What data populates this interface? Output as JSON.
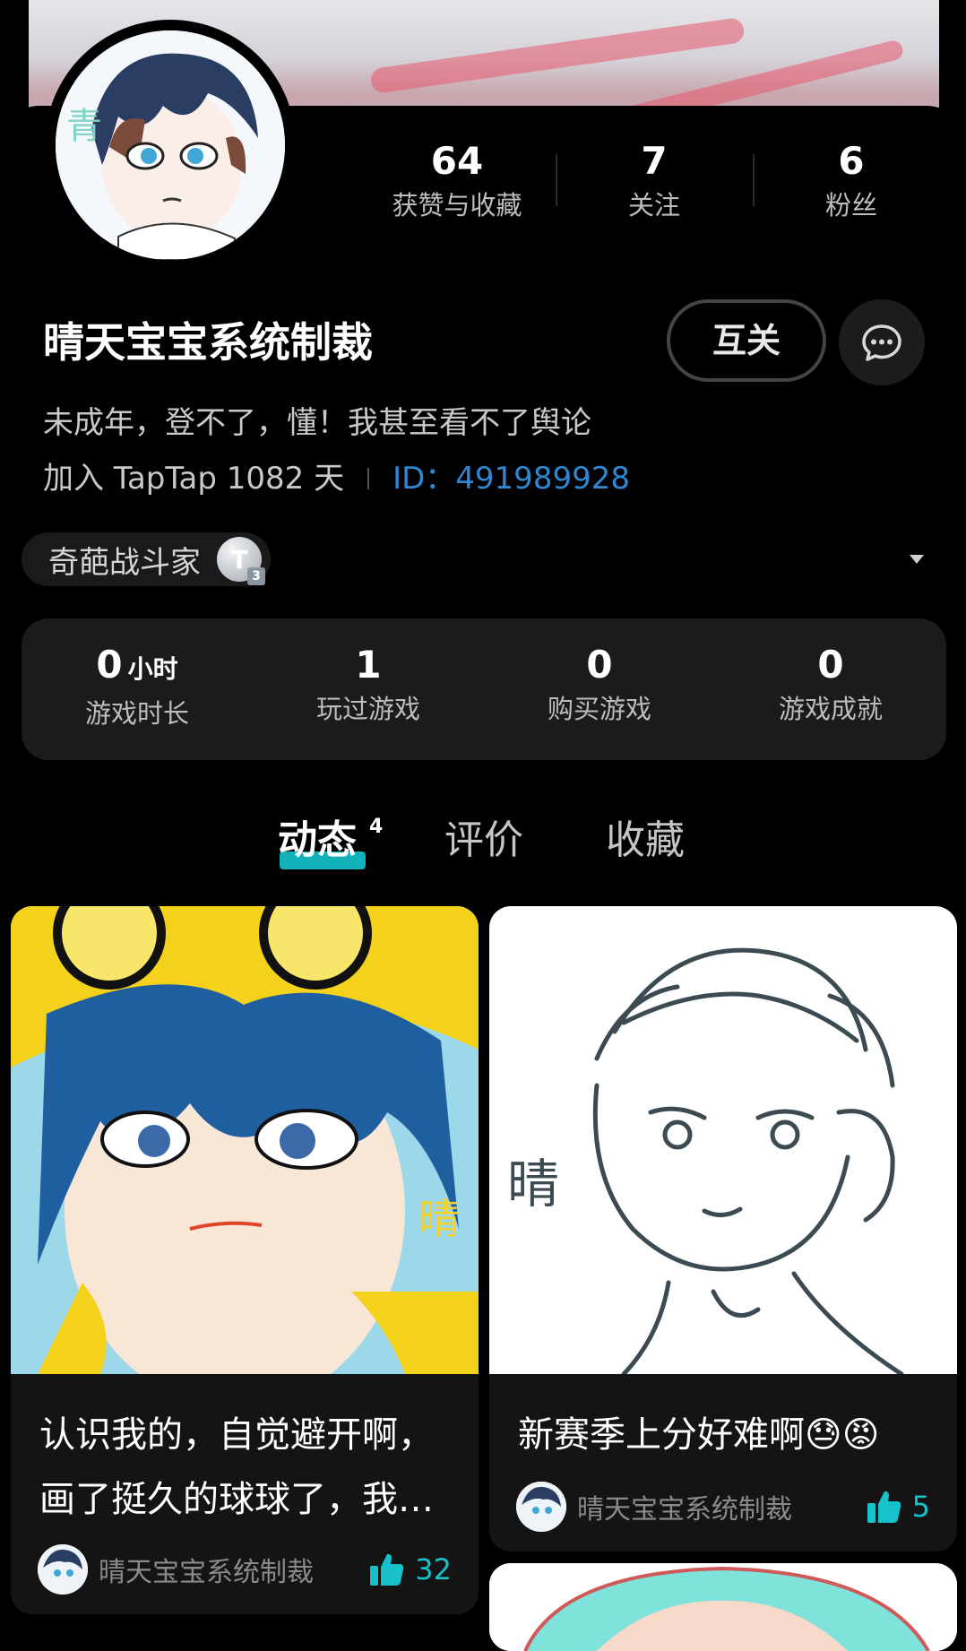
{
  "profile": {
    "name": "晴天宝宝系统制裁",
    "bio": "未成年，登不了，懂！我甚至看不了舆论",
    "join_text": "加入 TapTap 1082 天",
    "id_text": "ID：491989928",
    "mutual_label": "互关",
    "badge_label": "奇葩战斗家",
    "badge_icon_letter": "T",
    "badge_level": "3"
  },
  "stats": [
    {
      "value": "64",
      "label": "获赞与收藏"
    },
    {
      "value": "7",
      "label": "关注"
    },
    {
      "value": "6",
      "label": "粉丝"
    }
  ],
  "game_stats": [
    {
      "value": "0",
      "unit": "小时",
      "label": "游戏时长"
    },
    {
      "value": "1",
      "unit": "",
      "label": "玩过游戏"
    },
    {
      "value": "0",
      "unit": "",
      "label": "购买游戏"
    },
    {
      "value": "0",
      "unit": "",
      "label": "游戏成就"
    }
  ],
  "tabs": [
    {
      "label": "动态",
      "count": "4"
    },
    {
      "label": "评价"
    },
    {
      "label": "收藏"
    }
  ],
  "posts": [
    {
      "title": "认识我的，自觉避开啊，画了挺久的球球了，我…",
      "author": "晴天宝宝系统制裁",
      "likes": "32"
    },
    {
      "title": "新赛季上分好难啊😓😡",
      "author": "晴天宝宝系统制裁",
      "likes": "5"
    }
  ],
  "icons": [
    "message-icon",
    "dropdown-triangle-icon",
    "thumbs-up-icon",
    "badge-t-icon"
  ],
  "colors": {
    "accent_teal": "#15c5ce",
    "id_blue": "#2f87d2",
    "background": "#000000"
  }
}
